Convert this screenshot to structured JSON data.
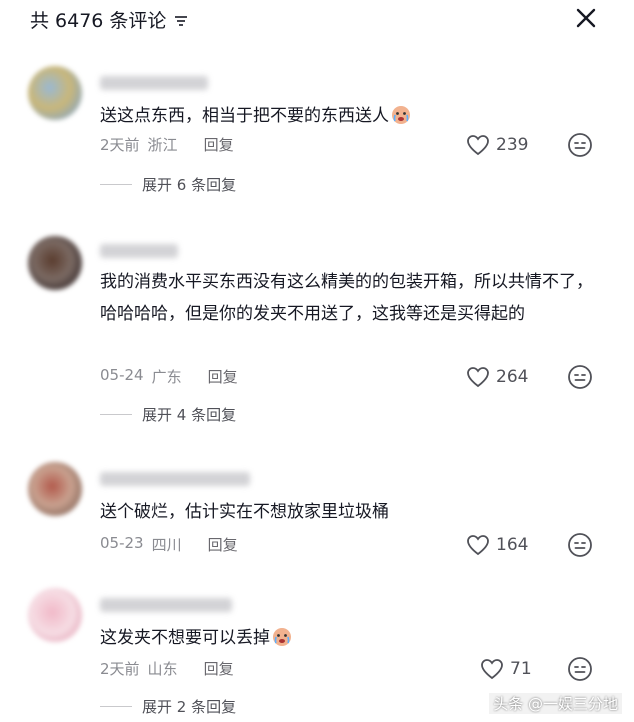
{
  "header": {
    "title": "共 6476 条评论"
  },
  "comments": [
    {
      "text": "送这点东西，相当于把不要的东西送人",
      "date": "2天前",
      "location": "浙江",
      "reply_label": "回复",
      "likes": "239",
      "expand_label": "展开 6 条回复"
    },
    {
      "text": "我的消费水平买东西没有这么精美的的包装开箱，所以共情不了，哈哈哈哈，但是你的发夹不用送了，这我等还是买得起的",
      "date": "05-24",
      "location": "广东",
      "reply_label": "回复",
      "likes": "264",
      "expand_label": "展开 4 条回复"
    },
    {
      "text": "送个破烂，估计实在不想放家里垃圾桶",
      "date": "05-23",
      "location": "四川",
      "reply_label": "回复",
      "likes": "164"
    },
    {
      "text": "这发夹不想要可以丢掉",
      "date": "2天前",
      "location": "山东",
      "reply_label": "回复",
      "likes": "71",
      "expand_label": "展开 2 条回复"
    }
  ],
  "watermark": "头条 @一娱三分地",
  "colors": {
    "text": "#161823",
    "meta": "#8a8b91",
    "icon": "#505158"
  }
}
